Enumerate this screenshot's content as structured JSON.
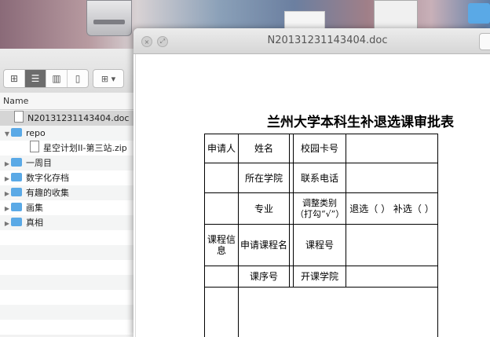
{
  "finder": {
    "column_header": "Name",
    "items": [
      {
        "name": "N20131231143404.doc",
        "kind": "doc",
        "indent": 1,
        "selected": true
      },
      {
        "name": "repo",
        "kind": "folder",
        "expanded": true
      },
      {
        "name": "星空计划II-第三站.zip",
        "kind": "doc",
        "indent": 2
      },
      {
        "name": "一周目",
        "kind": "folder"
      },
      {
        "name": "数字化存档",
        "kind": "folder"
      },
      {
        "name": "有趣的收集",
        "kind": "folder"
      },
      {
        "name": "画集",
        "kind": "folder"
      },
      {
        "name": "真相",
        "kind": "folder"
      }
    ]
  },
  "doc_window": {
    "title": "N20131231143404.doc"
  },
  "document": {
    "heading": "兰州大学本科生补退选课审批表",
    "cells": {
      "applicant": "申请人",
      "name": "姓名",
      "campus_card": "校园卡号",
      "college": "所在学院",
      "phone": "联系电话",
      "major": "专业",
      "adjust_type": "调整类别（打勾“√”）",
      "adjust_options": "退选（ ）  补选（ ）",
      "course_info": "课程信息",
      "course_name": "申请课程名",
      "course_no": "课程号",
      "course_seq": "课序号",
      "course_college": "开课学院"
    }
  }
}
